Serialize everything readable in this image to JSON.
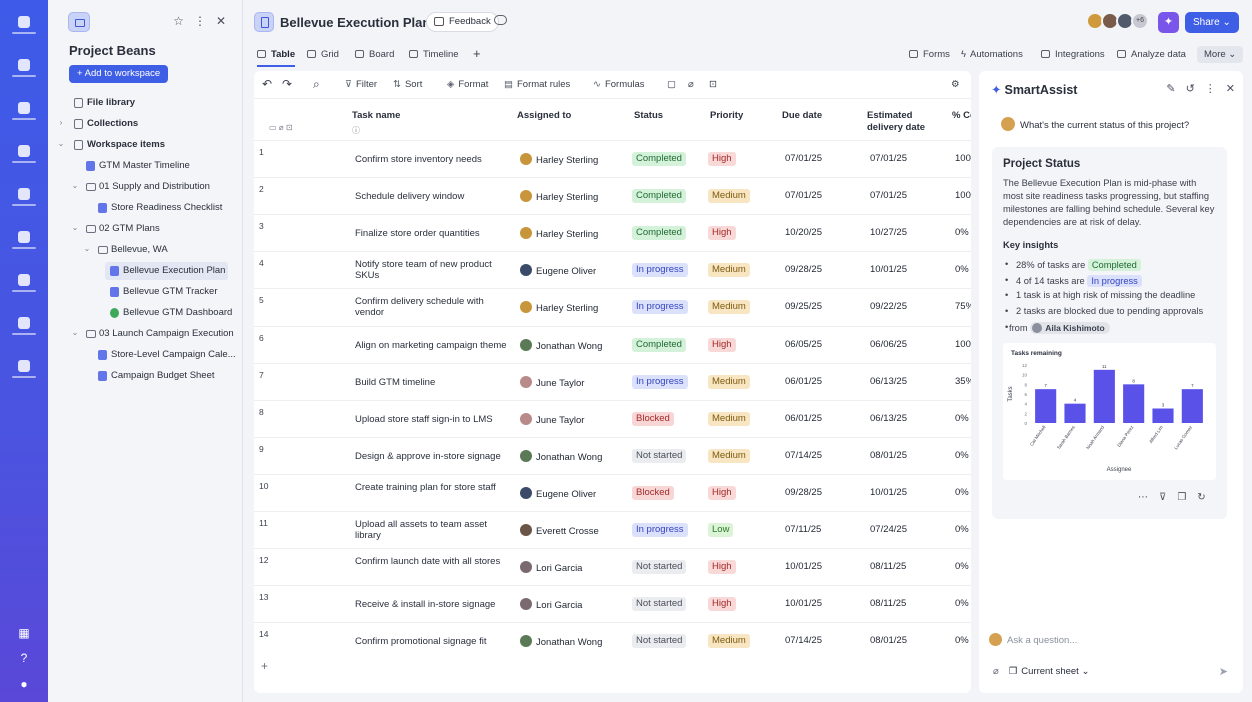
{
  "sidebar": {
    "title": "Project Beans",
    "add_workspace": "+ Add to workspace",
    "tree": [
      {
        "label": "File library",
        "icon": "library-icon",
        "depth": 0,
        "chevron": "",
        "bold": true
      },
      {
        "label": "Collections",
        "icon": "collections-icon",
        "depth": 0,
        "chevron": "›",
        "bold": true
      },
      {
        "label": "Workspace items",
        "icon": "workspace-icon",
        "depth": 0,
        "chevron": "⌄",
        "bold": true
      },
      {
        "label": "GTM Master Timeline",
        "icon": "sheet-icon",
        "depth": 1,
        "chevron": ""
      },
      {
        "label": "01 Supply and Distribution",
        "icon": "folder-icon",
        "depth": 1,
        "chevron": "⌄"
      },
      {
        "label": "Store Readiness Checklist",
        "icon": "sheet-icon",
        "depth": 2,
        "chevron": ""
      },
      {
        "label": "02 GTM Plans",
        "icon": "folder-icon",
        "depth": 1,
        "chevron": "⌄"
      },
      {
        "label": "Bellevue, WA",
        "icon": "folder-icon",
        "depth": 2,
        "chevron": "⌄"
      },
      {
        "label": "Bellevue Execution Plan",
        "icon": "sheet-icon",
        "depth": 3,
        "chevron": "",
        "active": true
      },
      {
        "label": "Bellevue GTM Tracker",
        "icon": "sheet-icon",
        "depth": 3,
        "chevron": ""
      },
      {
        "label": "Bellevue GTM Dashboard",
        "icon": "dashboard-icon",
        "depth": 3,
        "chevron": ""
      },
      {
        "label": "03 Launch Campaign Execution",
        "icon": "folder-icon",
        "depth": 1,
        "chevron": "⌄"
      },
      {
        "label": "Store-Level Campaign Cale...",
        "icon": "sheet-icon",
        "depth": 2,
        "chevron": ""
      },
      {
        "label": "Campaign Budget Sheet",
        "icon": "sheet-icon",
        "depth": 2,
        "chevron": ""
      }
    ]
  },
  "header": {
    "title": "Bellevue Execution Plan",
    "feedback": "Feedback",
    "share": "Share",
    "avatar_more": "+6"
  },
  "tabs": {
    "views": [
      "Table",
      "Grid",
      "Board",
      "Timeline"
    ],
    "add": "+",
    "right": [
      "Forms",
      "Automations",
      "Integrations",
      "Analyze data"
    ],
    "more": "More"
  },
  "toolbar": {
    "undo": "↶",
    "redo": "↷",
    "search": "⌕",
    "filter": "Filter",
    "sort": "Sort",
    "format": "Format",
    "format_rules": "Format rules",
    "formulas": "Formulas"
  },
  "table": {
    "columns": [
      "Task name",
      "Assigned to",
      "Status",
      "Priority",
      "Due date",
      "Estimated delivery date",
      "% Co"
    ],
    "rows": [
      {
        "num": "1",
        "task": "Confirm store inventory needs",
        "person": "Harley Sterling",
        "status": "Completed",
        "priority": "High",
        "due": "07/01/25",
        "est": "07/01/25",
        "pct": "100"
      },
      {
        "num": "2",
        "task": "Schedule delivery window",
        "person": "Harley Sterling",
        "status": "Completed",
        "priority": "Medium",
        "due": "07/01/25",
        "est": "07/01/25",
        "pct": "100"
      },
      {
        "num": "3",
        "task": "Finalize store order quantities",
        "person": "Harley Sterling",
        "status": "Completed",
        "priority": "High",
        "due": "10/20/25",
        "est": "10/27/25",
        "pct": "0%"
      },
      {
        "num": "4",
        "task": "Notify store team of new product SKUs",
        "person": "Eugene Oliver",
        "status": "In progress",
        "priority": "Medium",
        "due": "09/28/25",
        "est": "10/01/25",
        "pct": "0%"
      },
      {
        "num": "5",
        "task": "Confirm delivery schedule with vendor",
        "person": "Harley Sterling",
        "status": "In progress",
        "priority": "Medium",
        "due": "09/25/25",
        "est": "09/22/25",
        "pct": "75%"
      },
      {
        "num": "6",
        "task": "Align on marketing campaign theme",
        "person": "Jonathan Wong",
        "status": "Completed",
        "priority": "High",
        "due": "06/05/25",
        "est": "06/06/25",
        "pct": "100"
      },
      {
        "num": "7",
        "task": "Build GTM timeline",
        "person": "June Taylor",
        "status": "In progress",
        "priority": "Medium",
        "due": "06/01/25",
        "est": "06/13/25",
        "pct": "35%"
      },
      {
        "num": "8",
        "task": "Upload store staff sign-in to LMS",
        "person": "June Taylor",
        "status": "Blocked",
        "priority": "Medium",
        "due": "06/01/25",
        "est": "06/13/25",
        "pct": "0%"
      },
      {
        "num": "9",
        "task": "Design & approve in-store signage",
        "person": "Jonathan Wong",
        "status": "Not started",
        "priority": "Medium",
        "due": "07/14/25",
        "est": "08/01/25",
        "pct": "0%"
      },
      {
        "num": "10",
        "task": "Create training plan for store staff",
        "person": "Eugene Oliver",
        "status": "Blocked",
        "priority": "High",
        "due": "09/28/25",
        "est": "10/01/25",
        "pct": "0%"
      },
      {
        "num": "11",
        "task": "Upload all assets to team asset library",
        "person": "Everett Crosse",
        "status": "In progress",
        "priority": "Low",
        "due": "07/11/25",
        "est": "07/24/25",
        "pct": "0%"
      },
      {
        "num": "12",
        "task": "Confirm launch date with all stores",
        "person": "Lori Garcia",
        "status": "Not started",
        "priority": "High",
        "due": "10/01/25",
        "est": "08/11/25",
        "pct": "0%"
      },
      {
        "num": "13",
        "task": "Receive & install in-store signage",
        "person": "Lori Garcia",
        "status": "Not started",
        "priority": "High",
        "due": "10/01/25",
        "est": "08/11/25",
        "pct": "0%"
      },
      {
        "num": "14",
        "task": "Confirm promotional signage fit",
        "person": "Jonathan Wong",
        "status": "Not started",
        "priority": "Medium",
        "due": "07/14/25",
        "est": "08/01/25",
        "pct": "0%"
      }
    ],
    "add_row": "+"
  },
  "assist": {
    "title": "SmartAssist",
    "question": "What's the current status of this project?",
    "card_title": "Project Status",
    "summary": "The Bellevue Execution Plan is mid-phase with most site readiness tasks progressing, but staffing milestones are falling behind schedule. Several key dependencies are at risk of delay.",
    "key_insights": "Key insights",
    "insights": {
      "i1_pre": "28% of tasks are",
      "i1_pill": "Completed",
      "i2_pre": "4 of 14 tasks are",
      "i2_pill": "In progress",
      "i3": "1 task is at high risk of missing the deadline",
      "i4": "2 tasks are blocked due to pending approvals",
      "i4_from": "from",
      "i4_person": "Aila Kishimoto"
    },
    "ask_placeholder": "Ask a question...",
    "current_sheet": "Current sheet"
  },
  "chart_data": {
    "type": "bar",
    "title": "Tasks remaining",
    "xlabel": "Assignee",
    "ylabel": "Tasks",
    "categories": [
      "Cat Mitchell",
      "Sarah Barnes",
      "Noah Armand",
      "Diana Perez",
      "Alfred Lim",
      "Lucas Gomez"
    ],
    "values": [
      7,
      4,
      11,
      8,
      3,
      7
    ],
    "yticks": [
      12,
      10,
      8,
      6,
      4,
      2,
      0
    ],
    "ylim": [
      0,
      12
    ],
    "color": "#5a52e8"
  }
}
